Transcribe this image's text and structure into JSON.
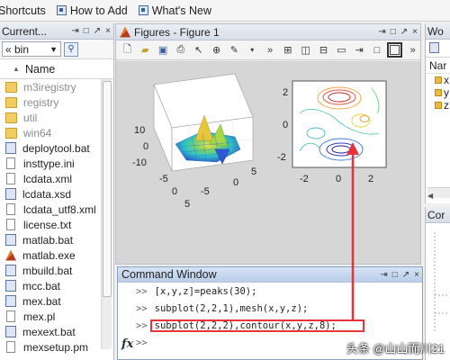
{
  "shortcuts": {
    "items": [
      {
        "label": "Shortcuts",
        "icon": "shortcut-icon"
      },
      {
        "label": "How to Add",
        "icon": "shortcut-icon"
      },
      {
        "label": "What's New",
        "icon": "shortcut-icon"
      }
    ]
  },
  "folder_panel": {
    "title": "Current...",
    "path_label": "« bin",
    "column_header": "Name",
    "sort_indicator": "▲",
    "items": [
      {
        "name": "m3iregistry",
        "type": "folder"
      },
      {
        "name": "registry",
        "type": "folder"
      },
      {
        "name": "util",
        "type": "folder"
      },
      {
        "name": "win64",
        "type": "folder"
      },
      {
        "name": "deploytool.bat",
        "type": "bat"
      },
      {
        "name": "insttype.ini",
        "type": "file"
      },
      {
        "name": "lcdata.xml",
        "type": "file"
      },
      {
        "name": "lcdata.xsd",
        "type": "bat"
      },
      {
        "name": "lcdata_utf8.xml",
        "type": "file"
      },
      {
        "name": "license.txt",
        "type": "file"
      },
      {
        "name": "matlab.bat",
        "type": "bat"
      },
      {
        "name": "matlab.exe",
        "type": "exe"
      },
      {
        "name": "mbuild.bat",
        "type": "bat"
      },
      {
        "name": "mcc.bat",
        "type": "bat"
      },
      {
        "name": "mex.bat",
        "type": "bat"
      },
      {
        "name": "mex.pl",
        "type": "file"
      },
      {
        "name": "mexext.bat",
        "type": "bat"
      },
      {
        "name": "mexsetup.pm",
        "type": "file"
      }
    ]
  },
  "figure": {
    "title": "Figures - Figure 1",
    "mesh_axes": {
      "z_ticks": [
        "10",
        "0",
        "-10"
      ],
      "x_ticks": [
        "-5",
        "0",
        "5"
      ],
      "y_ticks": [
        "-5"
      ]
    },
    "contour_axes": {
      "y_ticks": [
        "2",
        "0",
        "-2"
      ],
      "x_ticks": [
        "-2",
        "0",
        "2"
      ]
    }
  },
  "workspace": {
    "title": "Wo",
    "header": "Nar",
    "vars": [
      "x",
      "y",
      "z"
    ],
    "panel2_title": "Cor"
  },
  "command_window": {
    "title": "Command Window",
    "prompt": ">>",
    "lines": [
      "[x,y,z]=peaks(30);",
      "subplot(2,2,1),mesh(x,y,z);",
      "subplot(2,2,2),contour(x,y,z,8);",
      ""
    ],
    "fx_label": "fx"
  },
  "watermark": "头条 @山山而川21",
  "colors": {
    "annotation": "#e8333a",
    "title_bar": "#d8dfe9"
  }
}
